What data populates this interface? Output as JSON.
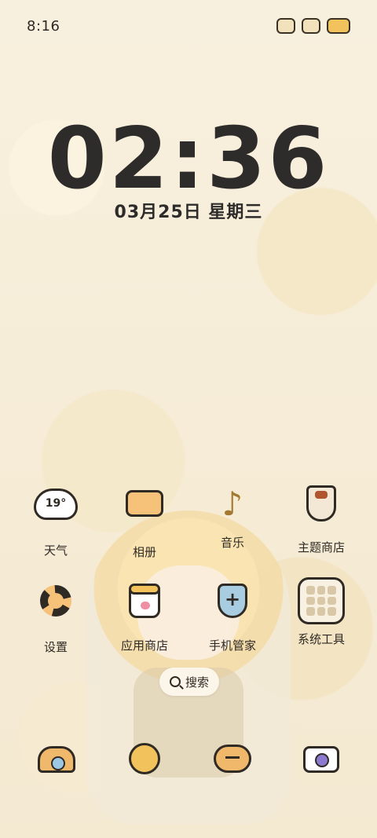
{
  "status_bar": {
    "time": "8:16",
    "icons": [
      "signal-icon",
      "wifi-icon",
      "battery-icon"
    ],
    "battery": "100"
  },
  "lockscreen": {
    "clock": "02:36",
    "date": "03月25日 星期三"
  },
  "apps": [
    {
      "label": "天气",
      "icon": "weather-icon",
      "temp": "19°"
    },
    {
      "label": "相册",
      "icon": "gallery-icon"
    },
    {
      "label": "音乐",
      "icon": "music-icon"
    },
    {
      "label": "主题商店",
      "icon": "theme-store-icon"
    },
    {
      "label": "设置",
      "icon": "settings-icon"
    },
    {
      "label": "应用商店",
      "icon": "app-store-icon"
    },
    {
      "label": "手机管家",
      "icon": "phone-manager-icon"
    },
    {
      "label": "系统工具",
      "icon": "system-tools-folder-icon"
    }
  ],
  "search": {
    "label": "搜索"
  },
  "dock": [
    {
      "icon": "phone-icon"
    },
    {
      "icon": "browser-icon"
    },
    {
      "icon": "messages-icon"
    },
    {
      "icon": "camera-icon"
    }
  ]
}
